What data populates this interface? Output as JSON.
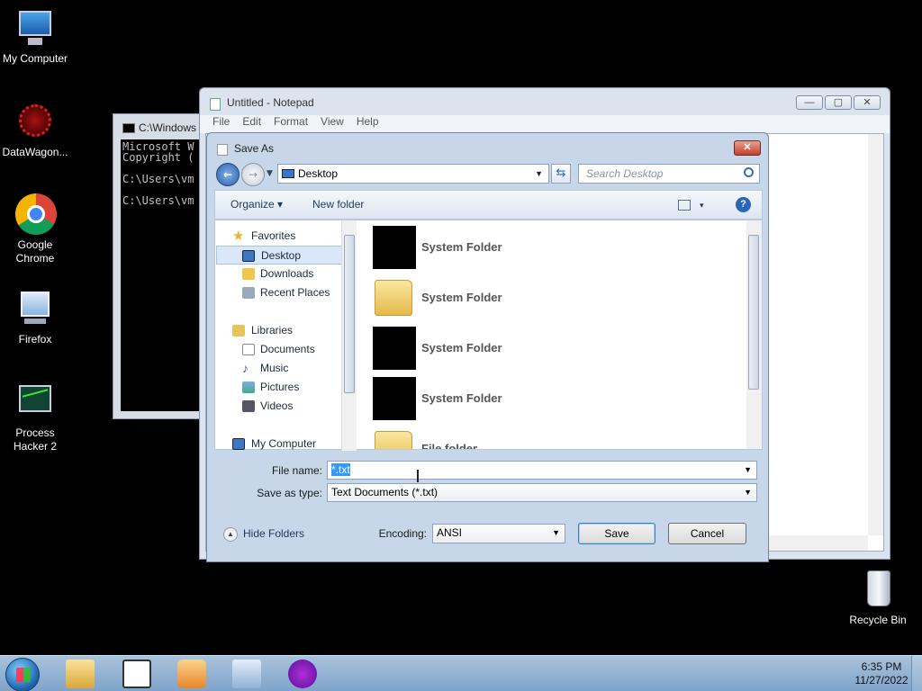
{
  "desktop": {
    "icons": [
      {
        "label": "My Computer",
        "icon": "computer-icon"
      },
      {
        "label": "DataWagon...",
        "icon": "datawagon-icon"
      },
      {
        "label": "Google Chrome",
        "icon": "chrome-icon"
      },
      {
        "label": "Firefox",
        "icon": "firefox-icon"
      },
      {
        "label": "Process Hacker 2",
        "icon": "process-hacker-icon"
      },
      {
        "label": "Recycle Bin",
        "icon": "recycle-bin-icon"
      }
    ]
  },
  "cmd": {
    "title": "C:\\Windows",
    "lines": "Microsoft W\nCopyright (\n\nC:\\Users\\vm\n\nC:\\Users\\vm"
  },
  "notepad": {
    "title": "Untitled - Notepad",
    "menu": [
      "File",
      "Edit",
      "Format",
      "View",
      "Help"
    ],
    "buttons": {
      "minimize": "—",
      "maximize": "▢",
      "close": "✕"
    }
  },
  "dialog": {
    "title": "Save As",
    "close_label": "✕",
    "address": "Desktop",
    "search_placeholder": "Search Desktop",
    "toolbar": {
      "organize": "Organize ▾",
      "new_folder": "New folder",
      "views": "▾",
      "help": "?"
    },
    "nav": {
      "favorites": "Favorites",
      "desktop": "Desktop",
      "downloads": "Downloads",
      "recent": "Recent Places",
      "libraries": "Libraries",
      "documents": "Documents",
      "music": "Music",
      "pictures": "Pictures",
      "videos": "Videos",
      "my_computer": "My Computer"
    },
    "files": [
      {
        "name": "System Folder",
        "thumb": "black"
      },
      {
        "name": "System Folder",
        "thumb": "folder"
      },
      {
        "name": "System Folder",
        "thumb": "black"
      },
      {
        "name": "System Folder",
        "thumb": "black"
      },
      {
        "name": "File folder",
        "thumb": "folder"
      }
    ],
    "file_name_label": "File name:",
    "file_name_value": "*.txt",
    "save_as_type_label": "Save as type:",
    "save_as_type_value": "Text Documents (*.txt)",
    "hide_folders": "Hide Folders",
    "encoding_label": "Encoding:",
    "encoding_value": "ANSI",
    "save": "Save",
    "cancel": "Cancel"
  },
  "taskbar": {
    "time": "6:35 PM",
    "date": "11/27/2022"
  },
  "colors": {
    "selection": "#3399ff",
    "taskbar": "#8fb0d3",
    "close_button": "#c5402c"
  }
}
